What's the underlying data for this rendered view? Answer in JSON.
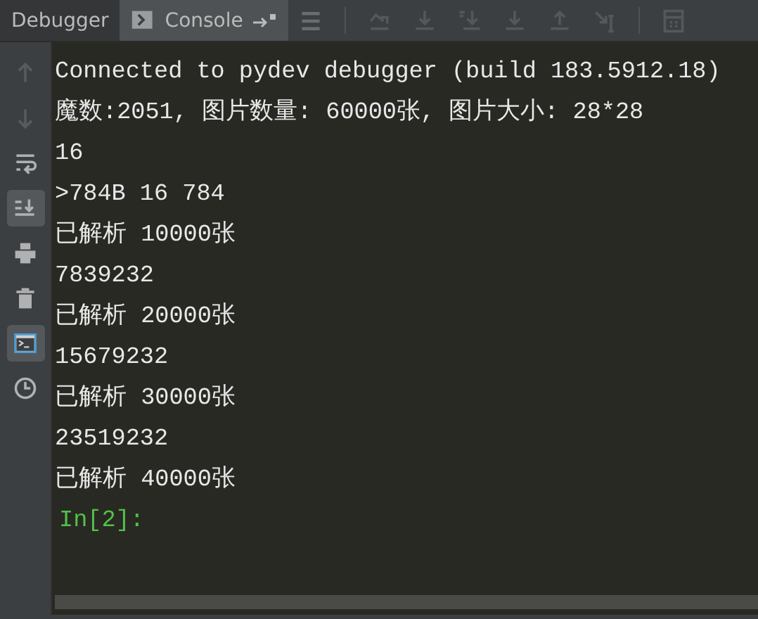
{
  "tabs": [
    {
      "label": "Debugger",
      "selected": false,
      "kind": "text"
    },
    {
      "label": "Console",
      "selected": true,
      "kind": "console"
    }
  ],
  "toolbar": [
    {
      "kind": "menu",
      "disabled": false
    },
    {
      "kind": "step-over",
      "disabled": true
    },
    {
      "kind": "step-into",
      "disabled": true
    },
    {
      "kind": "step-into-my",
      "disabled": true
    },
    {
      "kind": "force-step",
      "disabled": true
    },
    {
      "kind": "step-out",
      "disabled": true
    },
    {
      "kind": "run-to-cursor",
      "disabled": true
    },
    {
      "kind": "evaluate",
      "disabled": true
    }
  ],
  "sidebar": [
    {
      "kind": "up",
      "disabled": true,
      "on": false
    },
    {
      "kind": "down",
      "disabled": true,
      "on": false
    },
    {
      "kind": "wrap",
      "disabled": false,
      "on": false
    },
    {
      "kind": "scroll-end",
      "disabled": false,
      "on": true
    },
    {
      "kind": "print",
      "disabled": false,
      "on": false
    },
    {
      "kind": "trash",
      "disabled": false,
      "on": false
    },
    {
      "kind": "console",
      "disabled": false,
      "on": true
    },
    {
      "kind": "history",
      "disabled": false,
      "on": false
    }
  ],
  "console": {
    "lines": [
      {
        "kind": "output",
        "text": "Connected to pydev debugger (build 183.5912.18)"
      },
      {
        "kind": "output",
        "text": "魔数:2051, 图片数量: 60000张, 图片大小: 28*28"
      },
      {
        "kind": "output",
        "text": "16"
      },
      {
        "kind": "output",
        "text": ">784B 16 784"
      },
      {
        "kind": "output",
        "text": "已解析 10000张"
      },
      {
        "kind": "output",
        "text": "7839232"
      },
      {
        "kind": "output",
        "text": "已解析 20000张"
      },
      {
        "kind": "output",
        "text": "15679232"
      },
      {
        "kind": "output",
        "text": "已解析 30000张"
      },
      {
        "kind": "output",
        "text": "23519232"
      },
      {
        "kind": "output",
        "text": "已解析 40000张"
      },
      {
        "kind": "prompt",
        "text": "In[2]:"
      }
    ]
  }
}
